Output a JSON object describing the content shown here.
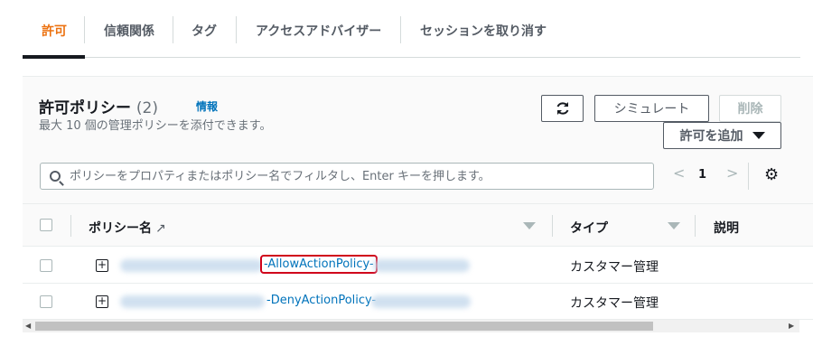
{
  "tabs": [
    "許可",
    "信頼関係",
    "タグ",
    "アクセスアドバイザー",
    "セッションを取り消す"
  ],
  "panel": {
    "title": "許可ポリシー",
    "count": "(2)",
    "info": "情報",
    "description": "最大 10 個の管理ポリシーを添付できます。",
    "refresh_icon": "refresh-icon",
    "simulate_label": "シミュレート",
    "delete_label": "削除",
    "add_label": "許可を追加"
  },
  "search": {
    "placeholder": "ポリシーをプロパティまたはポリシー名でフィルタし、Enter キーを押します。"
  },
  "pagination": {
    "prev": "<",
    "page": "1",
    "next": ">"
  },
  "table": {
    "columns": [
      "ポリシー名",
      "タイプ",
      "説明"
    ],
    "rows": [
      {
        "name": "-AllowActionPolicy-",
        "type": "カスタマー管理",
        "highlighted": true
      },
      {
        "name": "-DenyActionPolicy-",
        "type": "カスタマー管理",
        "highlighted": false
      }
    ]
  },
  "colors": {
    "accent": "#ec7211",
    "link": "#0073bb",
    "highlight": "#d0021b"
  }
}
